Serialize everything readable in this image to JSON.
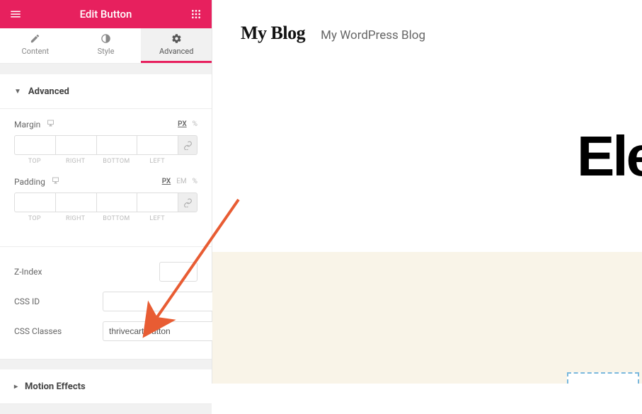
{
  "header": {
    "title": "Edit Button"
  },
  "tabs": {
    "content": "Content",
    "style": "Style",
    "advanced": "Advanced",
    "active": "advanced"
  },
  "sections": {
    "advanced": {
      "title": "Advanced",
      "margin": {
        "label": "Margin",
        "units": [
          "PX",
          "%"
        ],
        "active_unit": "PX",
        "sides": {
          "top": "TOP",
          "right": "RIGHT",
          "bottom": "BOTTOM",
          "left": "LEFT"
        },
        "values": {
          "top": "",
          "right": "",
          "bottom": "",
          "left": ""
        }
      },
      "padding": {
        "label": "Padding",
        "units": [
          "PX",
          "EM",
          "%"
        ],
        "active_unit": "PX",
        "sides": {
          "top": "TOP",
          "right": "RIGHT",
          "bottom": "BOTTOM",
          "left": "LEFT"
        },
        "values": {
          "top": "",
          "right": "",
          "bottom": "",
          "left": ""
        }
      },
      "zindex": {
        "label": "Z-Index",
        "value": ""
      },
      "css_id": {
        "label": "CSS ID",
        "value": ""
      },
      "css_classes": {
        "label": "CSS Classes",
        "value": "thrivecart-button"
      }
    },
    "motion_effects": {
      "title": "Motion Effects"
    }
  },
  "preview": {
    "site_title": "My Blog",
    "tagline": "My WordPress Blog",
    "big_text": "Ele"
  }
}
